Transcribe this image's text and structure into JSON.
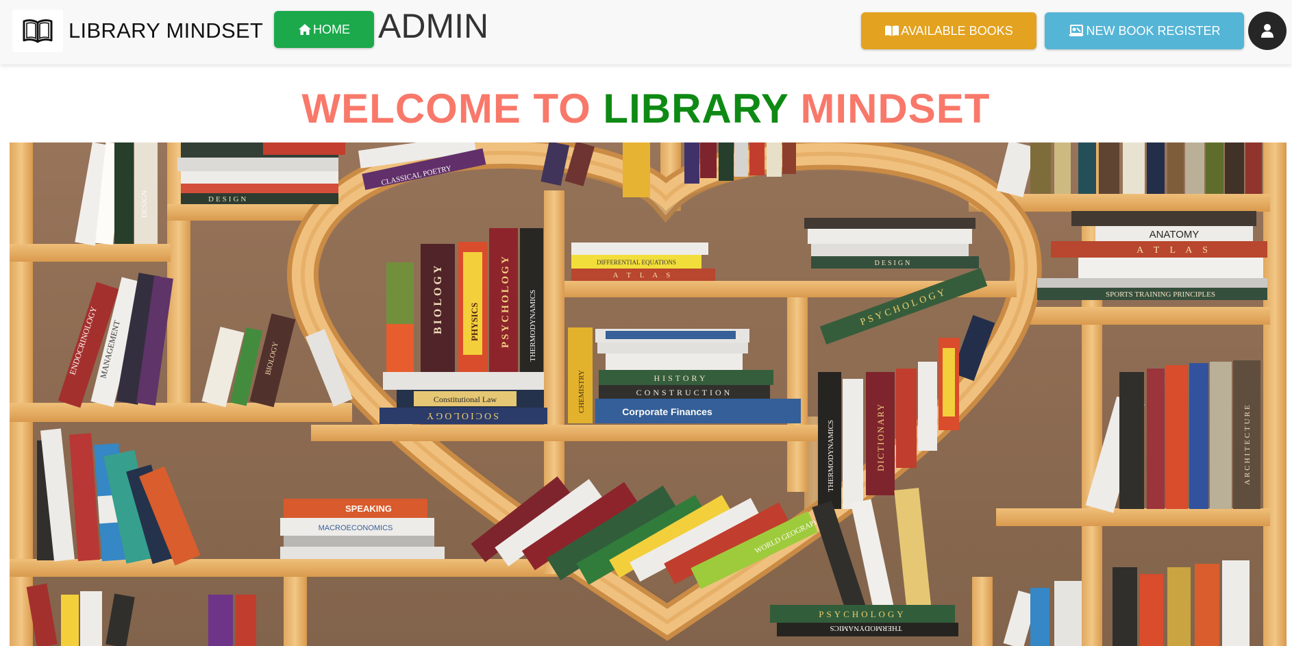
{
  "navbar": {
    "brand": {
      "name": "LIBRARY MINDSET",
      "icon": "open-book-icon"
    },
    "home_button": {
      "label": "HOME",
      "icon": "home-icon",
      "color": "#1ba94c"
    },
    "role_title": "ADMIN",
    "available_books_button": {
      "label": "AVAILABLE BOOKS",
      "icon": "book-icon",
      "color": "#e3a21f"
    },
    "new_book_register_button": {
      "label": "NEW BOOK REGISTER",
      "icon": "register-icon",
      "color": "#55b5d6"
    },
    "user_menu": {
      "icon": "user-icon"
    }
  },
  "welcome": {
    "part1": "WELCOME TO",
    "part2": "LIBRARY",
    "part3": "MINDSET",
    "colors": {
      "primary": "#f8786a",
      "accent": "#0e8a14"
    }
  },
  "hero": {
    "image": "heart-bookshelf-image",
    "spines": {
      "design": "DESIGN",
      "classical_poetry": "CLASSICAL POETRY",
      "biology": "BIOLOGY",
      "physics": "PHYSICS",
      "psychology": "PSYCHOLOGY",
      "thermodynamics": "THERMODYNAMICS",
      "anatomy": "ANATOMY",
      "atlas": "A T L A S",
      "sports": "SPORTS TRAINING PRINCIPLES",
      "history": "HISTORY",
      "construction": "CONSTRUCTION",
      "corporate_finances": "Corporate Finances",
      "constitutional_law": "Constitutional Law",
      "sociology": "SOCIOLOGY",
      "chemistry": "CHEMISTRY",
      "endocrinology": "ENDOCRINOLOGY",
      "management": "MANAGEMENT",
      "dictionary": "DICTIONARY",
      "public_speaking": "SPEAKING",
      "macroeconomics": "MACROECONOMICS",
      "architecture": "ARCHITECTURE",
      "world_geography": "WORLD GEOGRAPHY",
      "differential_equations": "DIFFERENTIAL EQUATIONS"
    }
  }
}
